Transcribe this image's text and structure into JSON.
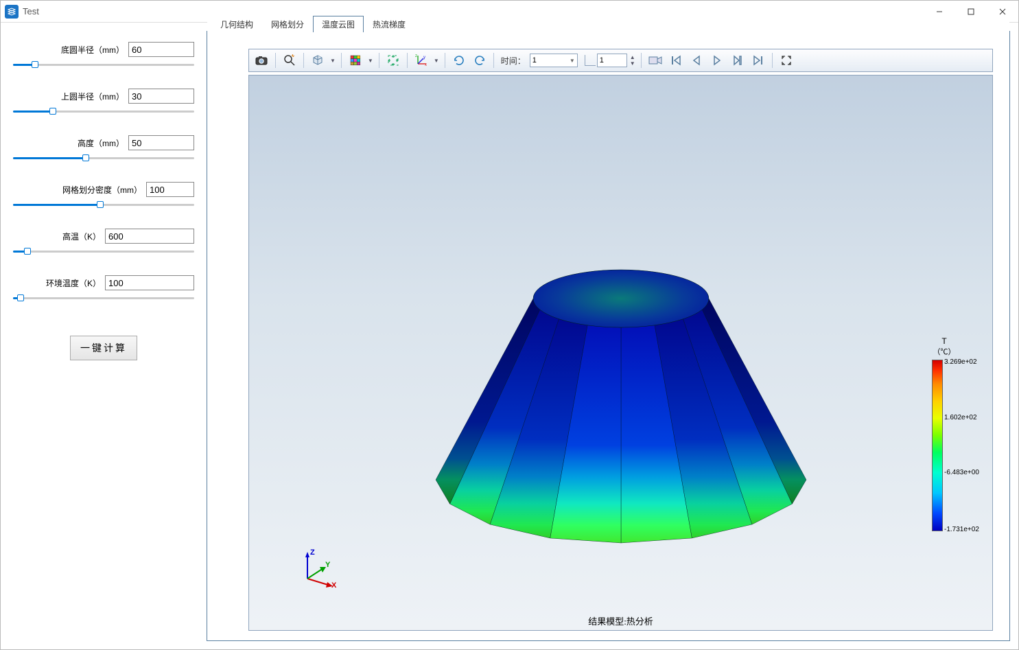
{
  "window": {
    "title": "Test"
  },
  "params": [
    {
      "key": "bottom_radius",
      "label": "底圆半径（mm）",
      "value": "60",
      "pct": 12
    },
    {
      "key": "top_radius",
      "label": "上圆半径（mm）",
      "value": "30",
      "pct": 22
    },
    {
      "key": "height",
      "label": "高度（mm）",
      "value": "50",
      "pct": 40
    },
    {
      "key": "mesh_density",
      "label": "网格划分密度（mm）",
      "value": "100",
      "pct": 48,
      "wide": true
    },
    {
      "key": "high_temp",
      "label": "高温（K）",
      "value": "600",
      "pct": 8,
      "input_wide": true
    },
    {
      "key": "env_temp",
      "label": "环境温度（K）",
      "value": "100",
      "pct": 4,
      "input_wide": true
    }
  ],
  "calc_button": "一键计算",
  "tabs": [
    {
      "label": "几何结构",
      "active": false
    },
    {
      "label": "网格划分",
      "active": false
    },
    {
      "label": "温度云图",
      "active": true
    },
    {
      "label": "热流梯度",
      "active": false
    }
  ],
  "toolbar": {
    "time_label": "时间：",
    "time_value": "1",
    "frame_value": "1"
  },
  "viewport": {
    "caption": "结果模型:热分析",
    "axes": {
      "x": "X",
      "y": "Y",
      "z": "Z"
    }
  },
  "legend": {
    "title": "T",
    "unit": "（℃）",
    "ticks": [
      {
        "pos": 0,
        "label": "3.269e+02"
      },
      {
        "pos": 33,
        "label": "1.602e+02"
      },
      {
        "pos": 66,
        "label": "-6.483e+00"
      },
      {
        "pos": 100,
        "label": "-1.731e+02"
      }
    ]
  }
}
